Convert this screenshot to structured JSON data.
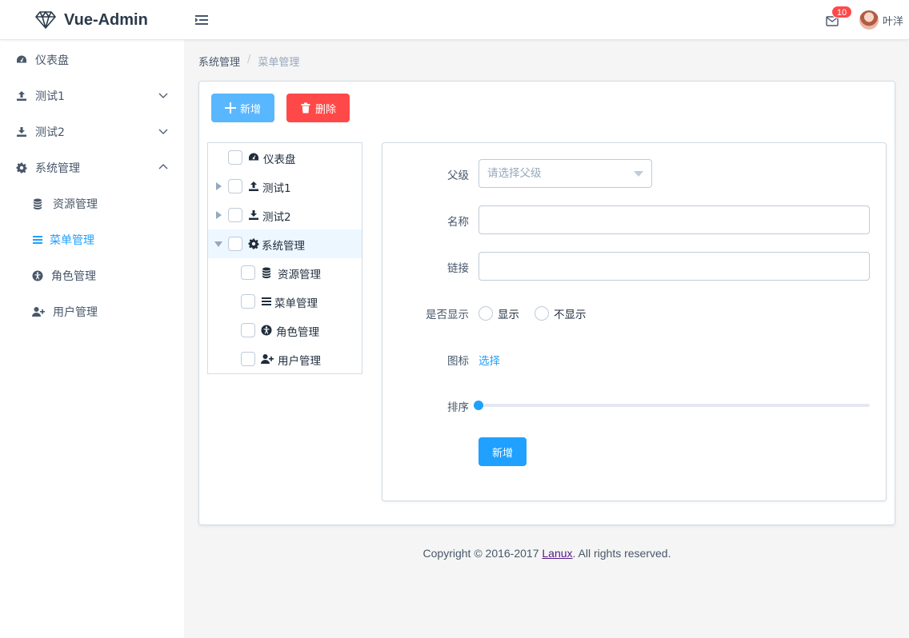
{
  "header": {
    "app_title": "Vue-Admin",
    "notification_count": "10",
    "username": "叶洋"
  },
  "sidebar": {
    "items": [
      {
        "label": "仪表盘",
        "icon": "dashboard-icon"
      },
      {
        "label": "测试1",
        "icon": "upload-icon",
        "expanded": false
      },
      {
        "label": "测试2",
        "icon": "download-icon",
        "expanded": false
      },
      {
        "label": "系统管理",
        "icon": "gear-icon",
        "expanded": true,
        "children": [
          {
            "label": "资源管理",
            "icon": "database-icon"
          },
          {
            "label": "菜单管理",
            "icon": "list-icon",
            "active": true
          },
          {
            "label": "角色管理",
            "icon": "accessibility-icon"
          },
          {
            "label": "用户管理",
            "icon": "user-plus-icon"
          }
        ]
      }
    ],
    "active_color": "#20a0ff"
  },
  "breadcrumb": {
    "items": [
      "系统管理",
      "菜单管理"
    ],
    "separator": "/"
  },
  "toolbar": {
    "add_label": "新增",
    "delete_label": "删除"
  },
  "tree": {
    "nodes": [
      {
        "label": "仪表盘",
        "icon": "dashboard-icon"
      },
      {
        "label": "测试1",
        "icon": "upload-icon"
      },
      {
        "label": "测试2",
        "icon": "download-icon"
      },
      {
        "label": "系统管理",
        "icon": "gear-icon"
      },
      {
        "label": "资源管理",
        "icon": "database-icon"
      },
      {
        "label": "菜单管理",
        "icon": "list-icon"
      },
      {
        "label": "角色管理",
        "icon": "accessibility-icon"
      },
      {
        "label": "用户管理",
        "icon": "user-plus-icon"
      }
    ]
  },
  "form": {
    "parent_label": "父级",
    "parent_placeholder": "请选择父级",
    "name_label": "名称",
    "name_value": "",
    "link_label": "链接",
    "link_value": "",
    "visible_label": "是否显示",
    "visible_options": [
      "显示",
      "不显示"
    ],
    "icon_label": "图标",
    "icon_select_link": "选择",
    "order_label": "排序",
    "order_value": 0,
    "submit_label": "新增"
  },
  "footer": {
    "prefix": "Copyright © 2016-2017 ",
    "link_text": "Lanux",
    "suffix": ". All rights reserved."
  },
  "colors": {
    "primary": "#20a0ff",
    "primary_light": "#58b7ff",
    "danger": "#ff4949",
    "badge": "#ff4949"
  }
}
